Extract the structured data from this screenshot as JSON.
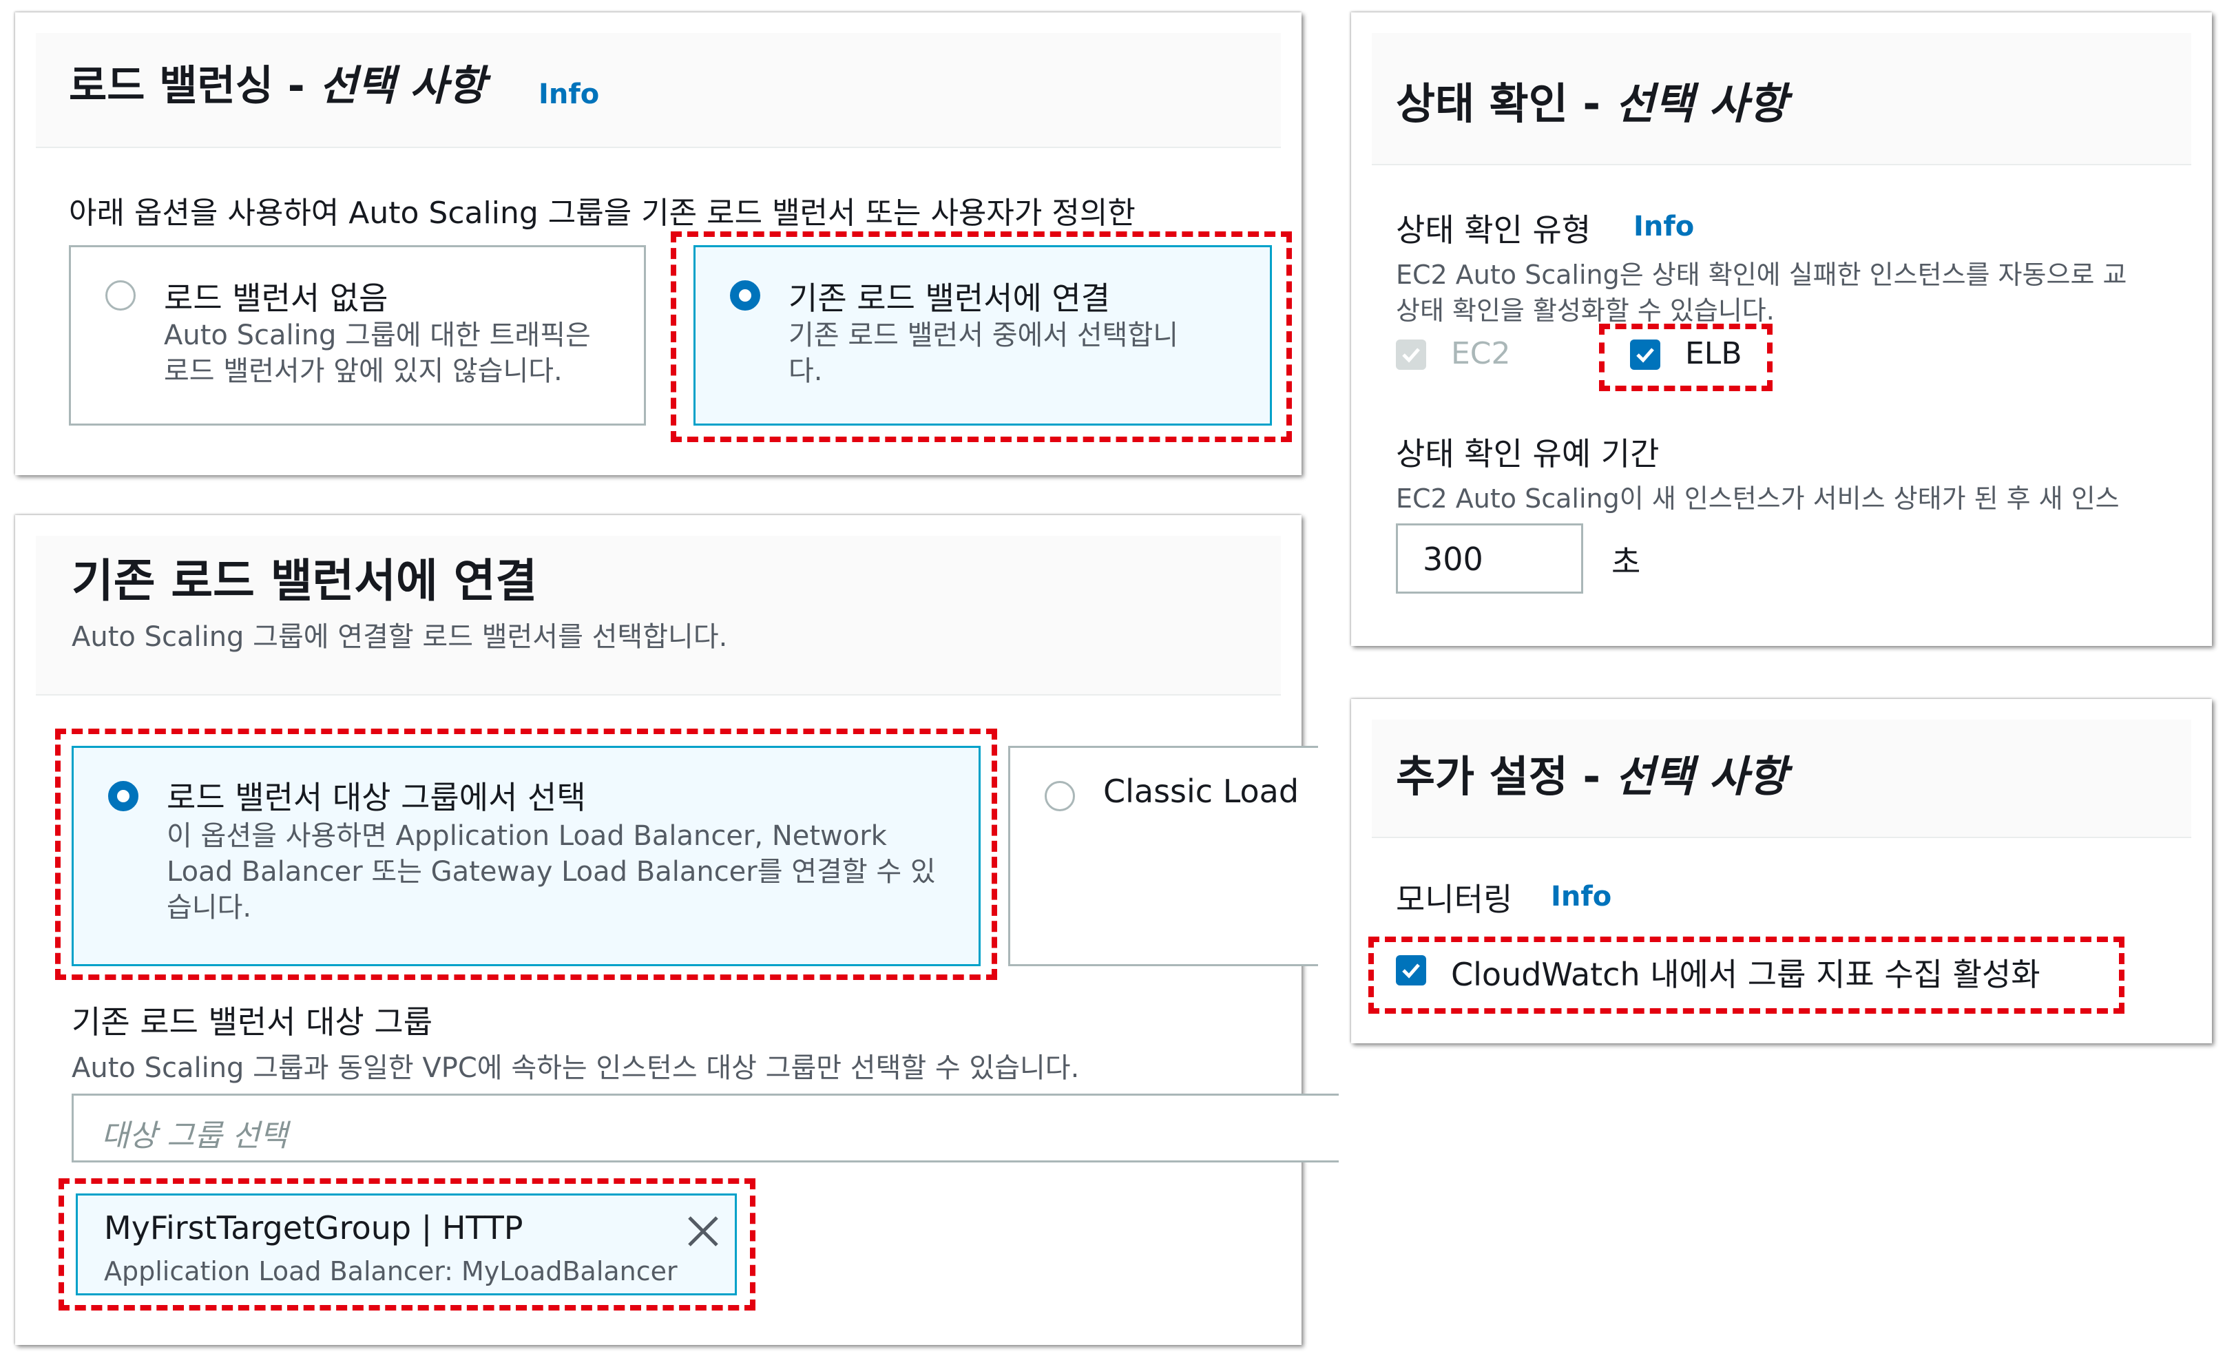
{
  "lb_panel": {
    "title_main": "로드 밸런싱 - ",
    "title_ital": "선택 사항",
    "info": "Info",
    "intro": "아래 옵션을 사용하여 Auto Scaling 그룹을 기존 로드 밸런서 또는 사용자가 정의한",
    "option_none": {
      "label": "로드 밸런서 없음",
      "desc_1": "Auto Scaling 그룹에 대한 트래픽은",
      "desc_2": "로드 밸런서가 앞에 있지 않습니다."
    },
    "option_existing": {
      "label": "기존 로드 밸런서에 연결",
      "desc_1": "기존 로드 밸런서 중에서 선택합니",
      "desc_2": "다."
    }
  },
  "attach_panel": {
    "title": "기존 로드 밸런서에 연결",
    "subtitle": "Auto Scaling 그룹에 연결할 로드 밸런서를 선택합니다.",
    "option_tg": {
      "label": "로드 밸런서 대상 그룹에서 선택",
      "desc_1": "이 옵션을 사용하면 Application Load Balancer, Network",
      "desc_2": "Load Balancer 또는 Gateway Load Balancer를 연결할 수 있",
      "desc_3": "습니다."
    },
    "option_classic": {
      "label": "Classic Load"
    },
    "tg_label": "기존 로드 밸런서 대상 그룹",
    "tg_desc": "Auto Scaling 그룹과 동일한 VPC에 속하는 인스턴스 대상 그룹만 선택할 수 있습니다.",
    "tg_placeholder": "대상 그룹 선택",
    "token": {
      "name": "MyFirstTargetGroup | HTTP",
      "sub": "Application Load Balancer: MyLoadBalancer"
    }
  },
  "health_panel": {
    "title_main": "상태 확인 - ",
    "title_ital": "선택 사항",
    "type_label": "상태 확인 유형",
    "info": "Info",
    "type_desc_1": "EC2 Auto Scaling은 상태 확인에 실패한 인스턴스를 자동으로 교",
    "type_desc_2": "상태 확인을 활성화할 수 있습니다.",
    "ec2_label": "EC2",
    "elb_label": "ELB",
    "grace_label": "상태 확인 유예 기간",
    "grace_desc": "EC2 Auto Scaling이 새 인스턴스가 서비스 상태가 된 후 새 인스",
    "grace_value": "300",
    "grace_unit": "초"
  },
  "extra_panel": {
    "title_main": "추가 설정 - ",
    "title_ital": "선택 사항",
    "monitor_label": "모니터링",
    "info": "Info",
    "cloudwatch_label": "CloudWatch 내에서 그룹 지표 수집 활성화"
  },
  "colors": {
    "accent": "#0073bb",
    "highlight": "#e3000f",
    "selected_border": "#00a1c9",
    "info": "#0073bb"
  }
}
